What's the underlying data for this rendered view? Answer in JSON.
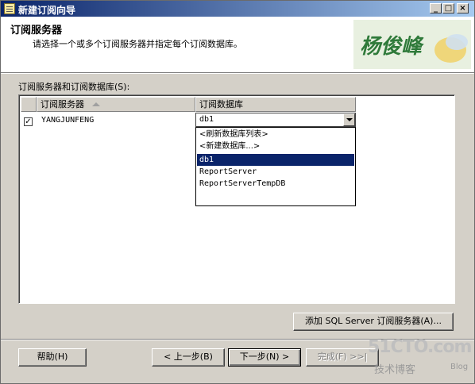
{
  "window": {
    "title": "新建订阅向导"
  },
  "header": {
    "title": "订阅服务器",
    "subtitle": "请选择一个或多个订阅服务器并指定每个订阅数据库。",
    "logo_text": "杨俊峰"
  },
  "section_label": "订阅服务器和订阅数据库(S):",
  "grid": {
    "columns": [
      "订阅服务器",
      "订阅数据库"
    ],
    "rows": [
      {
        "checked": true,
        "server": "YANGJUNFENG",
        "database": "db1"
      }
    ]
  },
  "dropdown": {
    "options": [
      "<刷新数据库列表>",
      "<新建数据库...>",
      "db1",
      "ReportServer",
      "ReportServerTempDB"
    ],
    "selected": "db1"
  },
  "buttons": {
    "add_label": "添加 SQL Server 订阅服务器(A)...",
    "help_label": "帮助(H)",
    "back_label": "< 上一步(B)",
    "next_label": "下一步(N) >",
    "finish_label": "完成(F) >>|"
  },
  "watermark": {
    "site": "51CTO.com",
    "line2": "技术博客",
    "line3": "Blog"
  }
}
